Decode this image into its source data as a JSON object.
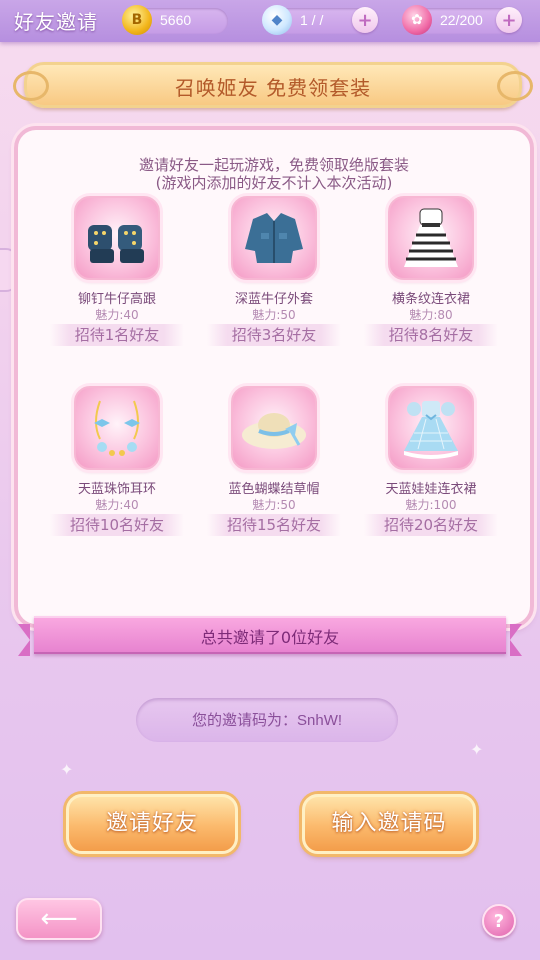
{
  "header": {
    "title": "好友邀请",
    "gold": "5660",
    "diamonds": "1 / /",
    "roses": "22/200",
    "icons": [
      "coin-icon",
      "diamond-icon",
      "rose-icon"
    ]
  },
  "banner": {
    "text": "召唤姬友 免费领套装"
  },
  "panel": {
    "intro_line1": "邀请好友一起玩游戏，免费领取绝版套装",
    "intro_line2": "(游戏内添加的好友不计入本次活动)",
    "items": [
      {
        "name": "铆钉牛仔高跟",
        "charm": "魅力:40",
        "requirement": "招待1名好友",
        "icon": "platform-heels-icon"
      },
      {
        "name": "深蓝牛仔外套",
        "charm": "魅力:50",
        "requirement": "招待3名好友",
        "icon": "denim-jacket-icon"
      },
      {
        "name": "横条纹连衣裙",
        "charm": "魅力:80",
        "requirement": "招待8名好友",
        "icon": "striped-dress-icon"
      },
      {
        "name": "天蓝珠饰耳环",
        "charm": "魅力:40",
        "requirement": "招待10名好友",
        "icon": "bead-earrings-icon"
      },
      {
        "name": "蓝色蝴蝶结草帽",
        "charm": "魅力:50",
        "requirement": "招待15名好友",
        "icon": "straw-hat-icon"
      },
      {
        "name": "天蓝娃娃连衣裙",
        "charm": "魅力:100",
        "requirement": "招待20名好友",
        "icon": "doll-dress-icon"
      }
    ]
  },
  "total": {
    "text": "总共邀请了0位好友"
  },
  "invite_code": {
    "label": "您的邀请码为：",
    "value": "SnhW!"
  },
  "buttons": {
    "invite": "邀请好友",
    "enter_code": "输入邀请码",
    "back_icon": "arrow-back-icon",
    "help": "?"
  }
}
